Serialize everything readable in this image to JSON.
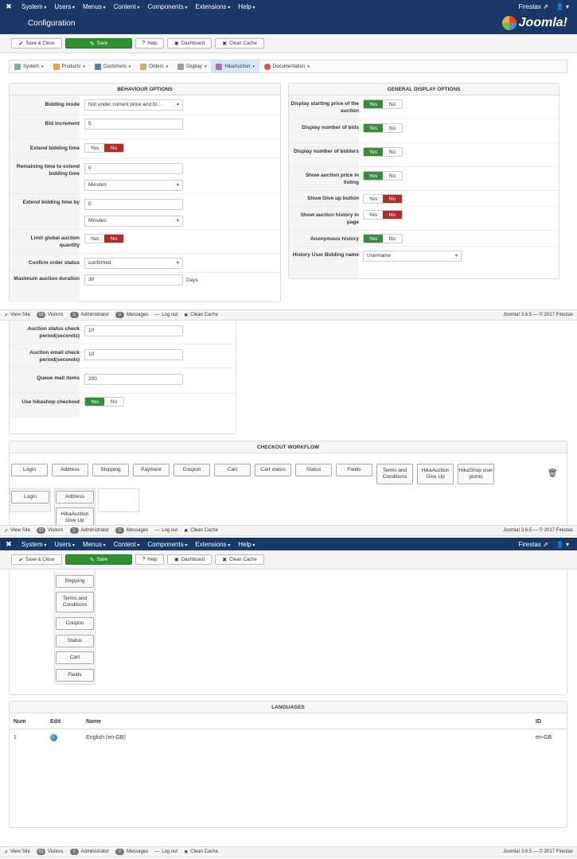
{
  "topbar": {
    "menus": [
      "System",
      "Users",
      "Menus",
      "Content",
      "Components",
      "Extensions",
      "Help"
    ],
    "site": "Firestax ⇗",
    "user": "👤 ▾"
  },
  "header": {
    "title": "Configuration",
    "brand": "Joomla!"
  },
  "toolbar": {
    "save_close": "Save & Close",
    "save": "Save",
    "help": "Help",
    "dashboard": "Dashboard",
    "clean_cache": "Clean Cache"
  },
  "subnav": [
    "System",
    "Products",
    "Customers",
    "Orders",
    "Display",
    "HikaAuction",
    "Documentation"
  ],
  "behaviour": {
    "title": "BEHAVIOUR OPTIONS",
    "bidding_mode_label": "Bidding mode",
    "bidding_mode_value": "Not under current price and bi...",
    "bid_increment_label": "Bid increment",
    "bid_increment_value": "5",
    "extend_label": "Extend bidding time",
    "remaining_label": "Remaining time to extend bidding time",
    "remaining_value": "0",
    "remaining_unit": "Minutes",
    "extend_by_label": "Extend bidding time by",
    "extend_by_value": "0",
    "extend_by_unit": "Minutes",
    "limit_label": "Limit global auction quantity",
    "confirm_label": "Confirm order status",
    "confirm_value": "confirmed",
    "max_duration_label": "Maximum auction duration",
    "max_duration_value": "30",
    "max_duration_unit": "Days",
    "status_check_label": "Auction status check period(seconds)",
    "status_check_value": "10",
    "email_check_label": "Auction email check period(seconds)",
    "email_check_value": "10",
    "queue_label": "Queue mail items",
    "queue_value": "200",
    "use_checkout_label": "Use hikashop checkout"
  },
  "display": {
    "title": "GENERAL DISPLAY OPTIONS",
    "starting_price_label": "Display starting price of the auction",
    "num_bids_label": "Display number of bids",
    "num_bidders_label": "Display number of bidders",
    "price_listing_label": "Show auction price in listing",
    "give_up_label": "Show Give up button",
    "history_label": "Show auction history in page",
    "anonymous_label": "Anonymous history",
    "history_user_label": "History User Bidding name",
    "history_user_value": "Username"
  },
  "toggle": {
    "yes": "Yes",
    "no": "No"
  },
  "status": {
    "view_site": "View Site",
    "visitors_count": "53",
    "visitors": "Visitors",
    "admin_count": "1",
    "admin": "Administrator",
    "messages_count": "0",
    "messages": "Messages",
    "logout": "Log out",
    "clean_cache": "Clean Cache",
    "copyright": "Joomla! 3.6.5 — © 2017 Firestax"
  },
  "workflow": {
    "title": "CHECKOUT WORKFLOW",
    "buttons": [
      "Login",
      "Address",
      "Shipping",
      "Payment",
      "Coupon",
      "Cart",
      "Cart status",
      "Status",
      "Fields",
      "Terms and Conditions",
      "HikaAuction Give Up",
      "HikaShop user points"
    ],
    "step1": "Login",
    "step2": [
      "Address",
      "HikaAuction Give Up",
      "Shipping",
      "Terms and Conditions",
      "Coupon",
      "Status",
      "Cart",
      "Fields"
    ]
  },
  "languages": {
    "title": "LANGUAGES",
    "headers": [
      "Num",
      "Edit",
      "Name",
      "ID"
    ],
    "rows": [
      {
        "num": "1",
        "name": "English (en-GB)",
        "id": "en-GB"
      }
    ]
  }
}
